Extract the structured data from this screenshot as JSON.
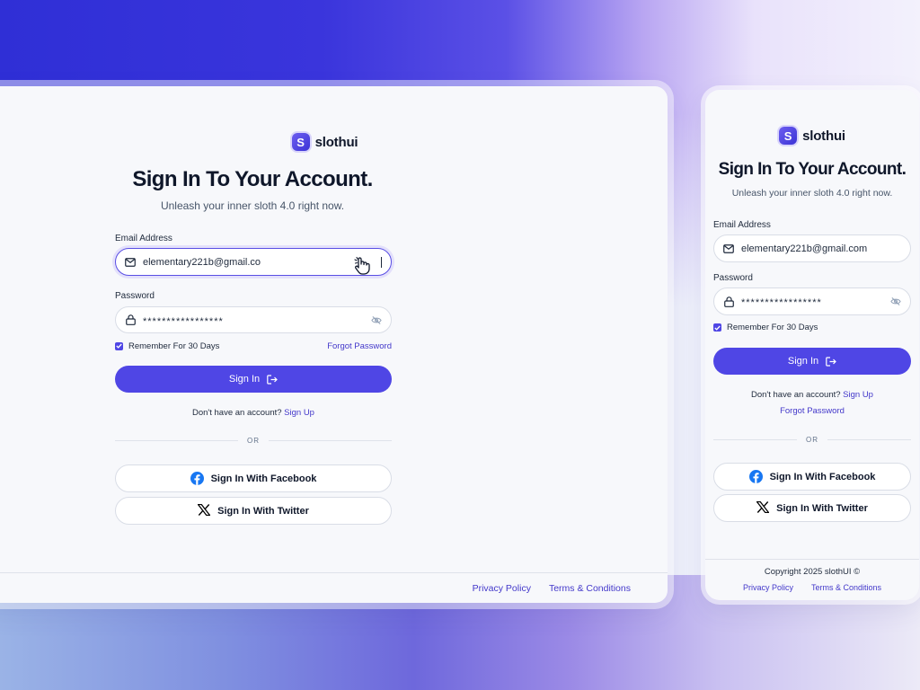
{
  "brand": {
    "logo_letter": "S",
    "name": "slothui"
  },
  "desktop": {
    "title": "Sign In To Your Account.",
    "subtitle": "Unleash your inner sloth 4.0 right now.",
    "email_label": "Email Address",
    "email_value": "elementary221b@gmail.co",
    "password_label": "Password",
    "password_value": "*****************",
    "remember_label": "Remember For 30 Days",
    "forgot_label": "Forgot Password",
    "signin_label": "Sign In",
    "no_account": "Don't have an account?",
    "signup_label": "Sign Up",
    "or_label": "OR",
    "facebook_label": "Sign In With Facebook",
    "twitter_label": "Sign In With Twitter",
    "footer": {
      "privacy": "Privacy Policy",
      "terms": "Terms & Conditions"
    }
  },
  "mobile": {
    "title": "Sign In To Your Account.",
    "subtitle": "Unleash your inner sloth 4.0 right now.",
    "email_label": "Email Address",
    "email_value": "elementary221b@gmail.com",
    "password_label": "Password",
    "password_value": "*****************",
    "remember_label": "Remember For 30 Days",
    "signin_label": "Sign In",
    "no_account": "Don't have an account?",
    "signup_label": "Sign Up",
    "forgot_label": "Forgot Password",
    "or_label": "OR",
    "facebook_label": "Sign In With Facebook",
    "twitter_label": "Sign In With Twitter",
    "footer": {
      "copyright": "Copyright 2025 slothUI ©",
      "privacy": "Privacy Policy",
      "terms": "Terms & Conditions"
    }
  },
  "icons": {
    "email": "mail-icon",
    "password": "lock-icon",
    "toggle": "eye-off-icon",
    "signin": "login-arrow-icon",
    "facebook": "facebook-icon",
    "twitter": "x-twitter-icon",
    "cursor": "hand-pointer-icon",
    "check": "checkbox-checked-icon"
  },
  "colors": {
    "accent": "#4f46e5",
    "link": "#4338ca",
    "facebook": "#1877f2",
    "text": "#0f172a"
  }
}
